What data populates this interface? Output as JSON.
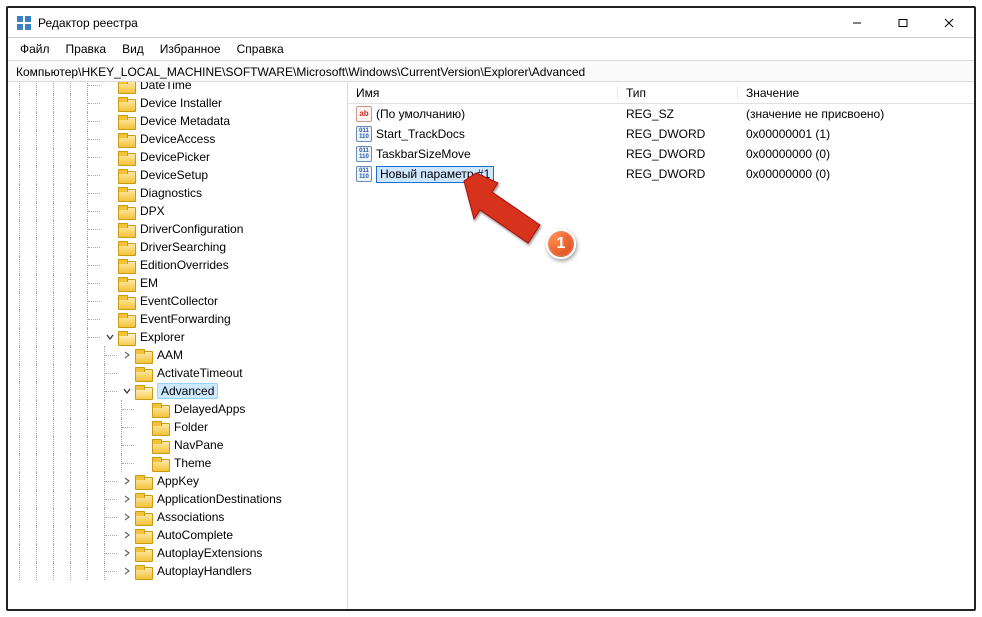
{
  "title": "Редактор реестра",
  "menu": [
    "Файл",
    "Правка",
    "Вид",
    "Избранное",
    "Справка"
  ],
  "address": "Компьютер\\HKEY_LOCAL_MACHINE\\SOFTWARE\\Microsoft\\Windows\\CurrentVersion\\Explorer\\Advanced",
  "columns": {
    "name": "Имя",
    "type": "Тип",
    "value": "Значение"
  },
  "values": [
    {
      "icon": "ab",
      "name": "(По умолчанию)",
      "type": "REG_SZ",
      "value": "(значение не присвоено)",
      "editing": false
    },
    {
      "icon": "dw",
      "name": "Start_TrackDocs",
      "type": "REG_DWORD",
      "value": "0x00000001 (1)",
      "editing": false
    },
    {
      "icon": "dw",
      "name": "TaskbarSizeMove",
      "type": "REG_DWORD",
      "value": "0x00000000 (0)",
      "editing": false
    },
    {
      "icon": "dw",
      "name": "Новый параметр #1",
      "type": "REG_DWORD",
      "value": "0x00000000 (0)",
      "editing": true
    }
  ],
  "tree": [
    {
      "depth": 8,
      "exp": "",
      "label": "DateTime"
    },
    {
      "depth": 8,
      "exp": "",
      "label": "Device Installer"
    },
    {
      "depth": 8,
      "exp": "",
      "label": "Device Metadata"
    },
    {
      "depth": 8,
      "exp": "",
      "label": "DeviceAccess"
    },
    {
      "depth": 8,
      "exp": "",
      "label": "DevicePicker"
    },
    {
      "depth": 8,
      "exp": "",
      "label": "DeviceSetup"
    },
    {
      "depth": 8,
      "exp": "",
      "label": "Diagnostics"
    },
    {
      "depth": 8,
      "exp": "",
      "label": "DPX"
    },
    {
      "depth": 8,
      "exp": "",
      "label": "DriverConfiguration"
    },
    {
      "depth": 8,
      "exp": "",
      "label": "DriverSearching"
    },
    {
      "depth": 8,
      "exp": "",
      "label": "EditionOverrides"
    },
    {
      "depth": 8,
      "exp": "",
      "label": "EM"
    },
    {
      "depth": 8,
      "exp": "",
      "label": "EventCollector"
    },
    {
      "depth": 8,
      "exp": "",
      "label": "EventForwarding"
    },
    {
      "depth": 8,
      "exp": "open",
      "label": "Explorer",
      "open": true
    },
    {
      "depth": 9,
      "exp": ">",
      "label": "AAM"
    },
    {
      "depth": 9,
      "exp": "",
      "label": "ActivateTimeout"
    },
    {
      "depth": 9,
      "exp": "open",
      "label": "Advanced",
      "open": true,
      "selected": true
    },
    {
      "depth": 10,
      "exp": "",
      "label": "DelayedApps"
    },
    {
      "depth": 10,
      "exp": "",
      "label": "Folder"
    },
    {
      "depth": 10,
      "exp": "",
      "label": "NavPane"
    },
    {
      "depth": 10,
      "exp": "",
      "label": "Theme"
    },
    {
      "depth": 9,
      "exp": ">",
      "label": "AppKey"
    },
    {
      "depth": 9,
      "exp": ">",
      "label": "ApplicationDestinations"
    },
    {
      "depth": 9,
      "exp": ">",
      "label": "Associations"
    },
    {
      "depth": 9,
      "exp": ">",
      "label": "AutoComplete"
    },
    {
      "depth": 9,
      "exp": ">",
      "label": "AutoplayExtensions"
    },
    {
      "depth": 9,
      "exp": ">",
      "label": "AutoplayHandlers"
    }
  ],
  "annotation": {
    "number": "1"
  }
}
